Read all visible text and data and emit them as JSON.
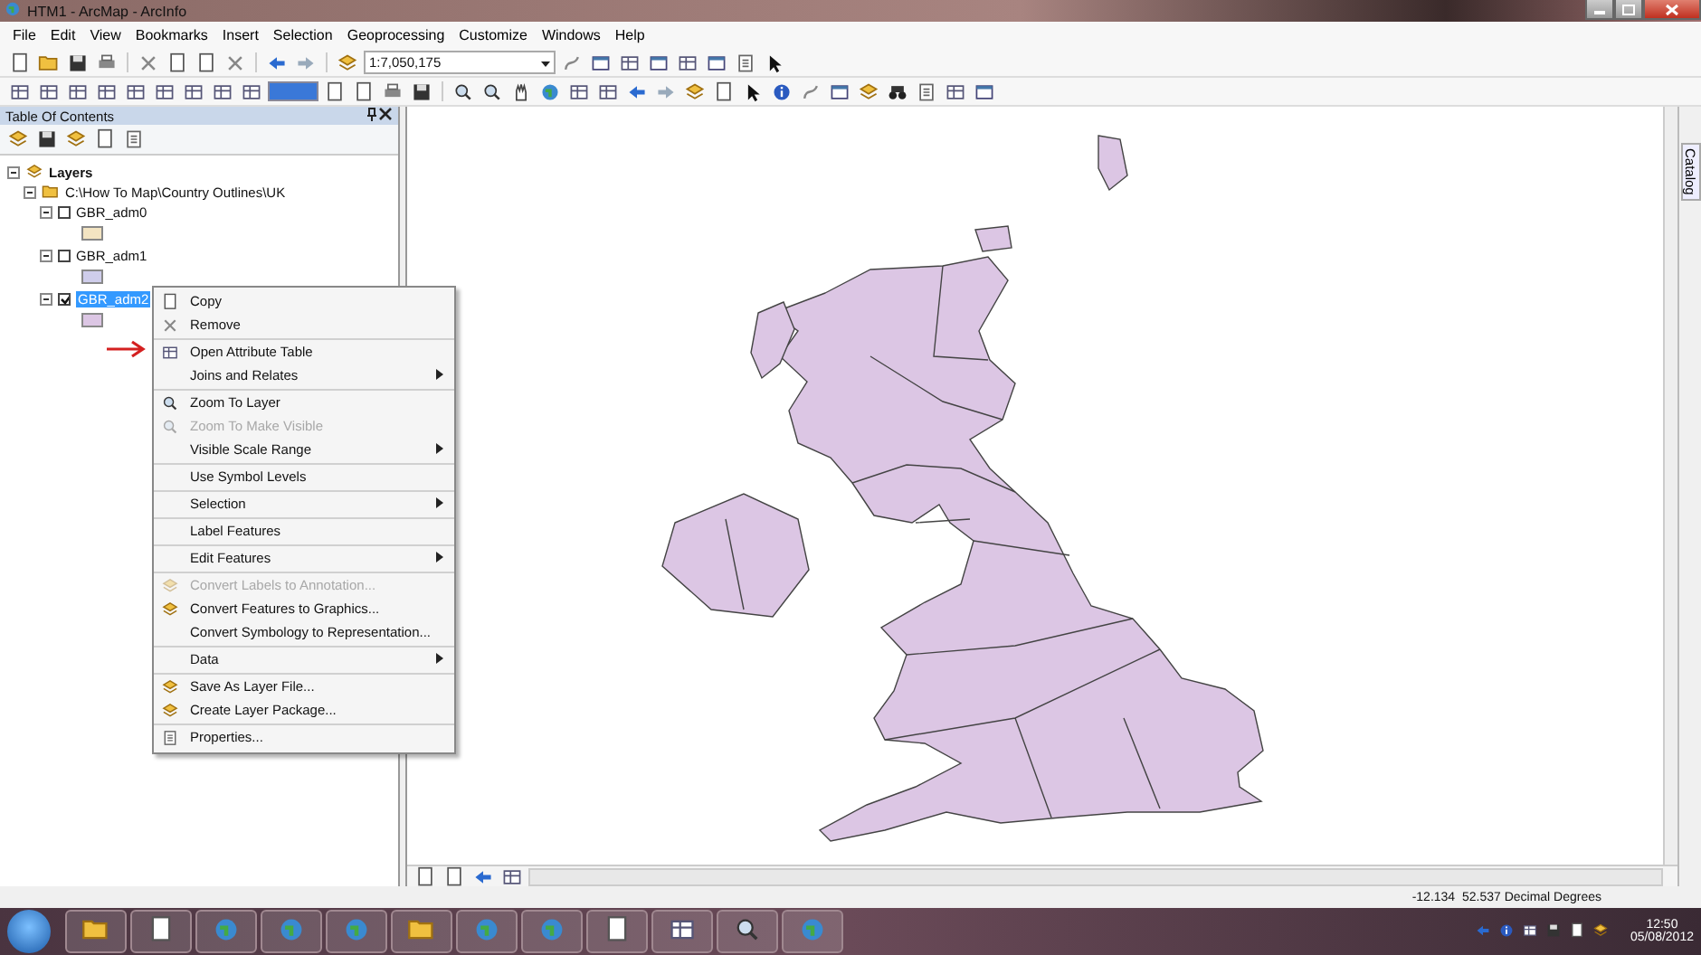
{
  "window": {
    "title": "HTM1 - ArcMap - ArcInfo"
  },
  "menu_bar": [
    "File",
    "Edit",
    "View",
    "Bookmarks",
    "Insert",
    "Selection",
    "Geoprocessing",
    "Customize",
    "Windows",
    "Help"
  ],
  "toolbar": {
    "scale": "1:7,050,175"
  },
  "table_of_contents": {
    "title": "Table Of Contents",
    "tree": [
      {
        "label": "Layers",
        "expanded": true,
        "children": [
          {
            "label": "C:\\How To Map\\Country Outlines\\UK",
            "expanded": true,
            "children": [
              {
                "label": "GBR_adm0",
                "expanded": true,
                "checked": false,
                "selected": false,
                "color": "#f3e4c2"
              },
              {
                "label": "GBR_adm1",
                "expanded": true,
                "checked": false,
                "selected": false,
                "color": "#cfcdeb"
              },
              {
                "label": "GBR_adm2",
                "expanded": true,
                "checked": true,
                "selected": true,
                "color": "#dcc6e4"
              }
            ]
          }
        ]
      }
    ]
  },
  "context_menu": {
    "groups": [
      [
        {
          "label": "Copy",
          "kind": "copy",
          "disabled": false,
          "submenu": false
        },
        {
          "label": "Remove",
          "kind": "remove",
          "disabled": false,
          "submenu": false
        }
      ],
      [
        {
          "label": "Open Attribute Table",
          "kind": "table",
          "disabled": false,
          "submenu": false
        },
        {
          "label": "Joins and Relates",
          "kind": "plain",
          "disabled": false,
          "submenu": true
        }
      ],
      [
        {
          "label": "Zoom To Layer",
          "kind": "zoom",
          "disabled": false,
          "submenu": false
        },
        {
          "label": "Zoom To Make Visible",
          "kind": "zoom",
          "disabled": true,
          "submenu": false
        },
        {
          "label": "Visible Scale Range",
          "kind": "plain",
          "disabled": false,
          "submenu": true
        }
      ],
      [
        {
          "label": "Use Symbol Levels",
          "kind": "plain",
          "disabled": false,
          "submenu": false
        }
      ],
      [
        {
          "label": "Selection",
          "kind": "plain",
          "disabled": false,
          "submenu": true
        }
      ],
      [
        {
          "label": "Label Features",
          "kind": "plain",
          "disabled": false,
          "submenu": false
        }
      ],
      [
        {
          "label": "Edit Features",
          "kind": "plain",
          "disabled": false,
          "submenu": true
        }
      ],
      [
        {
          "label": "Convert Labels to Annotation...",
          "kind": "convert",
          "disabled": true,
          "submenu": false
        },
        {
          "label": "Convert Features to Graphics...",
          "kind": "convert",
          "disabled": false,
          "submenu": false
        },
        {
          "label": "Convert Symbology to Representation...",
          "kind": "plain",
          "disabled": false,
          "submenu": false
        }
      ],
      [
        {
          "label": "Data",
          "kind": "plain",
          "disabled": false,
          "submenu": true
        }
      ],
      [
        {
          "label": "Save As Layer File...",
          "kind": "layer",
          "disabled": false,
          "submenu": false
        },
        {
          "label": "Create Layer Package...",
          "kind": "package",
          "disabled": false,
          "submenu": false
        }
      ],
      [
        {
          "label": "Properties...",
          "kind": "properties",
          "disabled": false,
          "submenu": false
        }
      ]
    ]
  },
  "catalog_tab": {
    "label": "Catalog"
  },
  "status_bar": {
    "coordinates": "-12.134  52.537 Decimal Degrees"
  },
  "taskbar": {
    "time": "12:50",
    "date": "05/08/2012"
  }
}
